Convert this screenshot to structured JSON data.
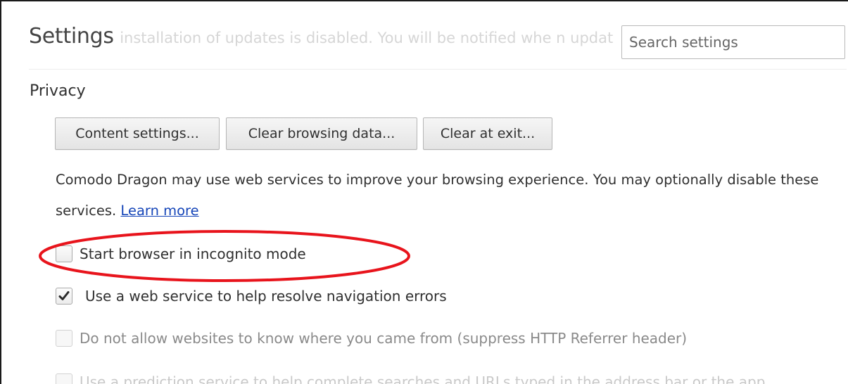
{
  "header": {
    "title": "Settings",
    "background_notice": "c installation of updates is disabled. You will be notified whe n updat",
    "search": {
      "placeholder": "Search settings",
      "value": ""
    }
  },
  "privacy": {
    "heading": "Privacy",
    "buttons": {
      "content_settings": "Content settings...",
      "clear_browsing_data": "Clear browsing data...",
      "clear_at_exit": "Clear at exit..."
    },
    "description": "Comodo Dragon may use web services to improve your browsing experience. You may optionally disable these services.",
    "learn_more": "Learn more",
    "options": [
      {
        "label": "Start browser in incognito mode",
        "checked": false,
        "enabled": true,
        "highlighted": true
      },
      {
        "label": "Use a web service to help resolve navigation errors",
        "checked": true,
        "enabled": true
      },
      {
        "label": "Do not allow websites to know where you came from (suppress HTTP Referrer header)",
        "checked": false,
        "enabled": false
      },
      {
        "label": "Use a prediction service to help complete searches and URLs typed in the address bar or the app",
        "checked": false,
        "enabled": false
      }
    ]
  },
  "colors": {
    "link": "#1545b8",
    "highlight_ring": "#e8141c",
    "text": "#303030",
    "disabled_text": "#8a8a8a"
  },
  "icons": {
    "checkmark": "checkmark-icon"
  }
}
